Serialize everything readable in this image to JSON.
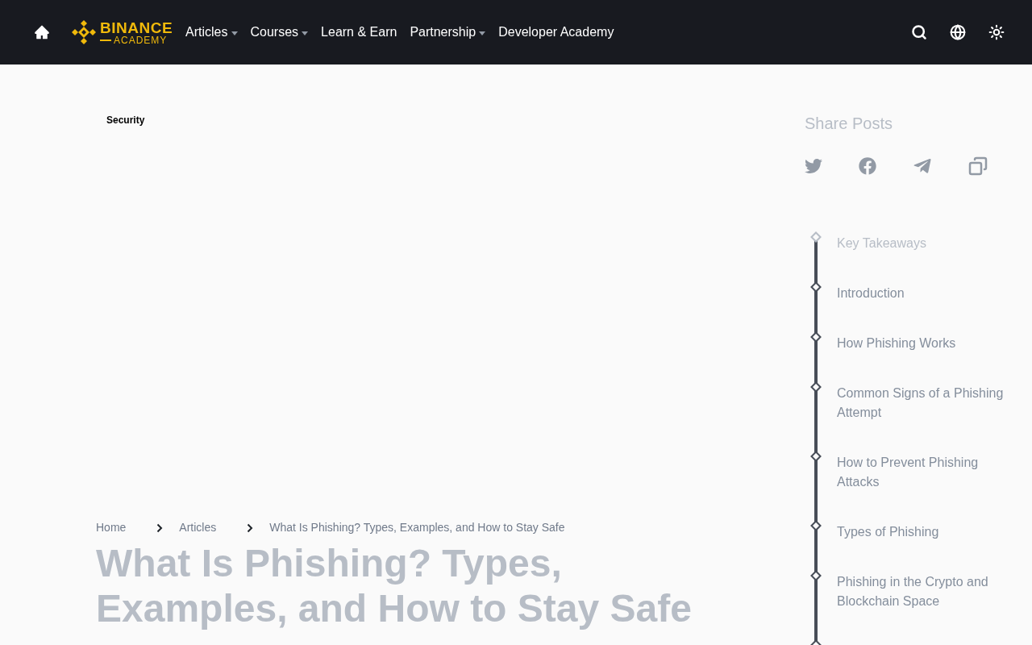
{
  "nav": {
    "logo": {
      "top": "BINANCE",
      "bottom": "ACADEMY"
    },
    "items": [
      {
        "label": "Articles",
        "dropdown": true
      },
      {
        "label": "Courses",
        "dropdown": true
      },
      {
        "label": "Learn & Earn",
        "dropdown": false
      },
      {
        "label": "Partnership",
        "dropdown": true
      },
      {
        "label": "Developer Academy",
        "dropdown": false
      }
    ]
  },
  "article": {
    "category": "Security",
    "breadcrumbs": [
      "Home",
      "Articles",
      "What Is Phishing? Types, Examples, and How to Stay Safe"
    ],
    "title": "What Is Phishing? Types, Examples, and How to Stay Safe"
  },
  "share": {
    "title": "Share Posts"
  },
  "toc": [
    {
      "label": "Key Takeaways",
      "dimmed": true
    },
    {
      "label": "Introduction",
      "dimmed": false
    },
    {
      "label": "How Phishing Works",
      "dimmed": false
    },
    {
      "label": "Common Signs of a Phishing Attempt",
      "dimmed": false
    },
    {
      "label": "How to Prevent Phishing Attacks",
      "dimmed": false
    },
    {
      "label": "Types of Phishing",
      "dimmed": false
    },
    {
      "label": "Phishing in the Crypto and Blockchain Space",
      "dimmed": false
    }
  ]
}
